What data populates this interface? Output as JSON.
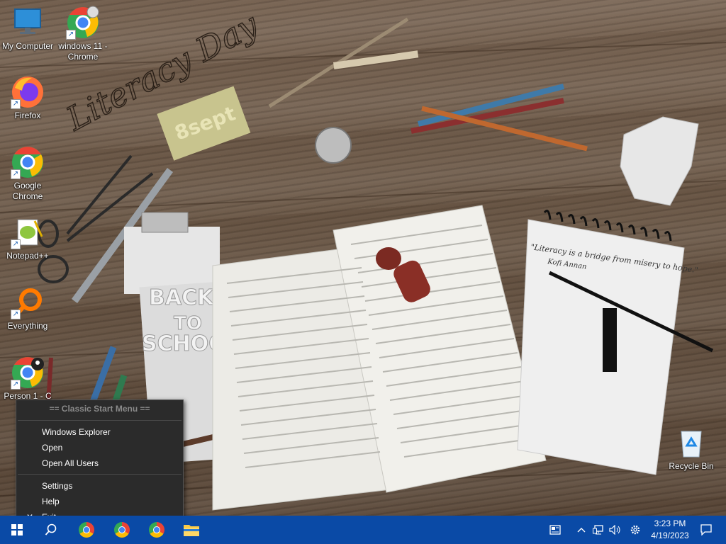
{
  "desktop": {
    "wallpaper_text": {
      "literacy_day": "Literacy Day",
      "date_sign": "8sept",
      "back_to_school": [
        "BACK",
        "TO",
        "SCHOOL"
      ],
      "notebook_quote": "\"Literacy is a bridge from misery to hope.\"",
      "notebook_author": "Kofi Annan"
    },
    "icons": [
      {
        "label": "My Computer",
        "icon": "monitor-icon"
      },
      {
        "label": "windows 11 - Chrome",
        "icon": "chrome-icon"
      },
      {
        "label": "Firefox",
        "icon": "firefox-icon"
      },
      {
        "label": "Google Chrome",
        "icon": "chrome-icon"
      },
      {
        "label": "Notepad++",
        "icon": "notepadpp-icon"
      },
      {
        "label": "Everything",
        "icon": "search-magnifier-icon"
      },
      {
        "label": "Person 1 - C",
        "icon": "chrome-profile-icon"
      },
      {
        "label": "Recycle Bin",
        "icon": "recycle-bin-icon"
      }
    ]
  },
  "start_menu": {
    "title": "== Classic Start Menu ==",
    "items": [
      {
        "label": "Windows Explorer"
      },
      {
        "label": "Open"
      },
      {
        "label": "Open All Users"
      },
      {
        "label": "Settings"
      },
      {
        "label": "Help"
      },
      {
        "label": "Exit",
        "mark": "✕"
      }
    ]
  },
  "taskbar": {
    "color": "#0a4aa6",
    "buttons": [
      {
        "name": "start",
        "icon": "windows-logo-icon"
      },
      {
        "name": "search",
        "icon": "search-icon"
      },
      {
        "name": "chrome-1",
        "icon": "chrome-icon"
      },
      {
        "name": "chrome-2",
        "icon": "chrome-icon"
      },
      {
        "name": "chrome-3",
        "icon": "chrome-icon"
      },
      {
        "name": "file-explorer",
        "icon": "folder-icon"
      }
    ],
    "tray": {
      "time": "3:23 PM",
      "date": "4/19/2023"
    }
  }
}
